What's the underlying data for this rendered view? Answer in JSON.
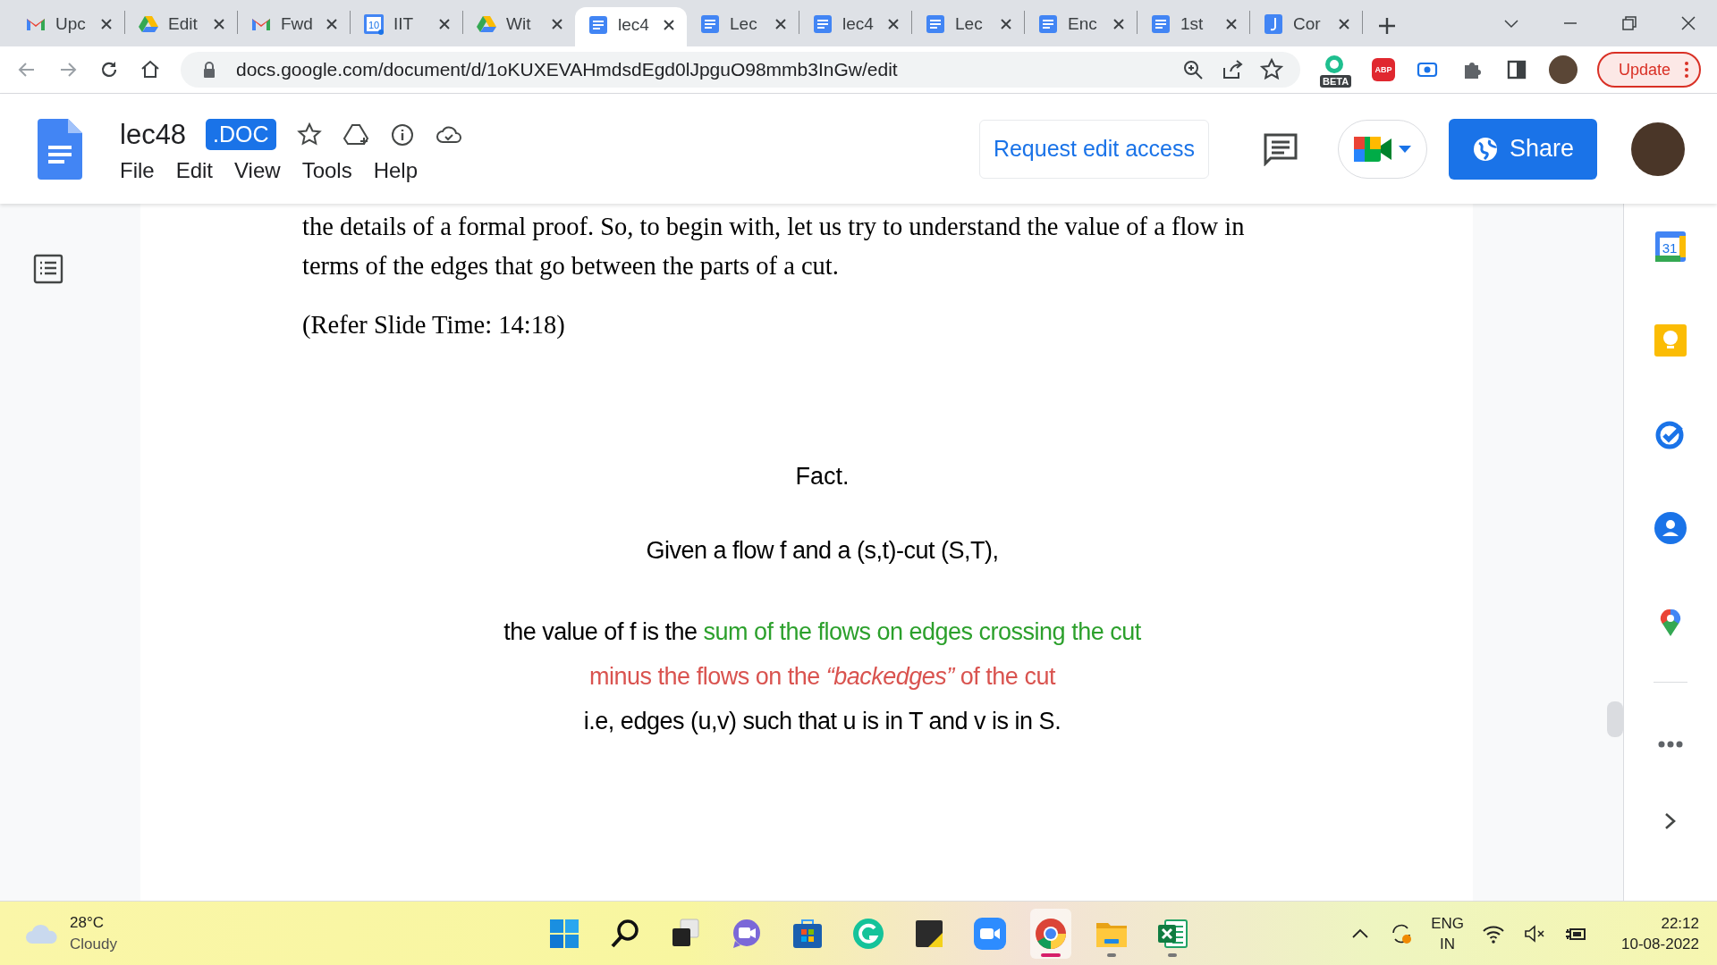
{
  "browser": {
    "tabs": [
      {
        "kind": "gmail",
        "label": "Upc",
        "selected": false
      },
      {
        "kind": "drive",
        "label": "Edit",
        "selected": false
      },
      {
        "kind": "gmail",
        "label": "Fwd",
        "selected": false
      },
      {
        "kind": "calendar",
        "label": "IIT",
        "selected": false
      },
      {
        "kind": "drive",
        "label": "Wit",
        "selected": false
      },
      {
        "kind": "docs",
        "label": "lec4",
        "selected": true
      },
      {
        "kind": "docs",
        "label": "Lec",
        "selected": false
      },
      {
        "kind": "docs",
        "label": "lec4",
        "selected": false
      },
      {
        "kind": "docs",
        "label": "Lec",
        "selected": false
      },
      {
        "kind": "docs",
        "label": "Enc",
        "selected": false
      },
      {
        "kind": "docs",
        "label": "1st",
        "selected": false
      },
      {
        "kind": "j",
        "label": "Cor",
        "selected": false
      }
    ],
    "calendar_tab_day": "10",
    "url": "docs.google.com/document/d/1oKUXEVAHmdsdEgd0lJpguO98mmb3InGw/edit",
    "beta_badge": "BETA",
    "abp_badge": "ABP",
    "update_button": "Update"
  },
  "docs": {
    "title": "lec48",
    "file_type": ".DOC",
    "menu": [
      "File",
      "Edit",
      "View",
      "Tools",
      "Help"
    ],
    "request_button": "Request edit access",
    "share_button": "Share"
  },
  "document": {
    "lines": [
      "the details of a formal proof. So, to begin with, let us try to understand the value of a flow in",
      "terms of the edges that go between the parts of a cut."
    ],
    "paragraphs": [
      "(Refer Slide Time: 14:18)"
    ],
    "slide": {
      "heading": "Fact.",
      "line": "Given a flow f and a (s,t)-cut (S,T),",
      "statement": [
        [
          {
            "text": "the value of f is the ",
            "color": "#000000"
          },
          {
            "text": "sum of the flows on edges crossing the cut",
            "color": "#2ca02c"
          }
        ],
        [
          {
            "text": "minus the flows on the *“backedges”* of the cut",
            "color": "#d9534f"
          }
        ],
        [
          {
            "text": "i.e, edges (u,v) such that u is in T and v is in S.",
            "color": "#000000"
          }
        ]
      ]
    }
  },
  "side_panel": {
    "calendar_day": "31"
  },
  "taskbar": {
    "weather": {
      "temp": "28°C",
      "condition": "Cloudy"
    },
    "apps": [
      {
        "kind": "start",
        "running": false,
        "selected": false
      },
      {
        "kind": "search",
        "running": false,
        "selected": false
      },
      {
        "kind": "taskview",
        "running": false,
        "selected": false
      },
      {
        "kind": "chat",
        "running": false,
        "selected": false
      },
      {
        "kind": "store",
        "running": false,
        "selected": false
      },
      {
        "kind": "grammarly",
        "running": false,
        "selected": false
      },
      {
        "kind": "notes",
        "running": false,
        "selected": false
      },
      {
        "kind": "zoom",
        "running": false,
        "selected": false
      },
      {
        "kind": "chrome",
        "running": true,
        "selected": true
      },
      {
        "kind": "folder",
        "running": true,
        "selected": false
      },
      {
        "kind": "excel",
        "running": true,
        "selected": false
      }
    ],
    "language": "ENG",
    "region": "IN",
    "time": "22:12",
    "date": "10-08-2022"
  }
}
